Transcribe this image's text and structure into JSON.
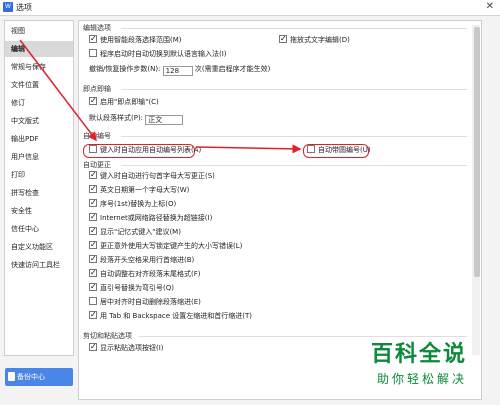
{
  "window": {
    "title": "选项",
    "app_icon": "W",
    "close": "✕"
  },
  "sidebar": {
    "items": [
      {
        "label": "视图"
      },
      {
        "label": "编辑"
      },
      {
        "label": "常规与保存"
      },
      {
        "label": "文件位置"
      },
      {
        "label": "修订"
      },
      {
        "label": "中文版式"
      },
      {
        "label": "输出PDF"
      },
      {
        "label": "用户信息"
      },
      {
        "label": "打印"
      },
      {
        "label": "拼写检查"
      },
      {
        "label": "安全性"
      },
      {
        "label": "信任中心"
      },
      {
        "label": "自定义功能区"
      },
      {
        "label": "快速访问工具栏"
      }
    ],
    "active_index": 1,
    "backup_label": "备份中心"
  },
  "sections": {
    "edit_options": {
      "title": "编辑选项",
      "ctrl_click": "使用智能段落选择范围(M)",
      "drag_edit": "拖放式文字编辑(D)",
      "ime_switch": "程序启动时自动切换到默认语言输入法(I)",
      "undo_label": "撤销/恢复操作步数(N):",
      "undo_value": "128",
      "undo_note": "次(需重启程序才能生效)"
    },
    "instant_click": {
      "title": "即点即输",
      "enable": "启用\"即点即输\"(C)",
      "default_style_label": "默认段落样式(P):",
      "default_style_value": "正文"
    },
    "auto_numbering": {
      "title": "自动编号",
      "apply_numbering": "键入时自动应用自动编号列表(A)",
      "circle_numbering": "自动带圆编号(U)"
    },
    "autocorrect": {
      "title": "自动更正",
      "items": [
        {
          "label": "键入时自动进行句首字母大写更正(S)"
        },
        {
          "label": "英文日期第一个字母大写(W)"
        },
        {
          "label": "序号(1st)替换为上标(O)"
        },
        {
          "label": "Internet或网络路径替换为超链接(I)"
        },
        {
          "label": "显示\"记忆式键入\"建议(M)"
        },
        {
          "label": "更正意外使用大写锁定键产生的大小写错误(L)"
        },
        {
          "label": "段落开头空格采用行首缩进(B)"
        },
        {
          "label": "自动调整右对齐段落末尾格式(F)"
        },
        {
          "label": "直引号替换为弯引号(Q)"
        },
        {
          "label": "居中对齐时自动删除段落缩进(E)"
        },
        {
          "label": "用 Tab 和 Backspace 设置左缩进和首行缩进(T)"
        }
      ]
    },
    "paste": {
      "title": "剪切和粘贴选项",
      "show_button": "显示粘贴选项按钮(I)"
    }
  },
  "watermark": {
    "main": "百科全说",
    "sub": "助你轻松解决"
  },
  "colors": {
    "accent": "#4a86e8",
    "highlight": "#e0202a",
    "watermark": "#0b8a3a"
  }
}
